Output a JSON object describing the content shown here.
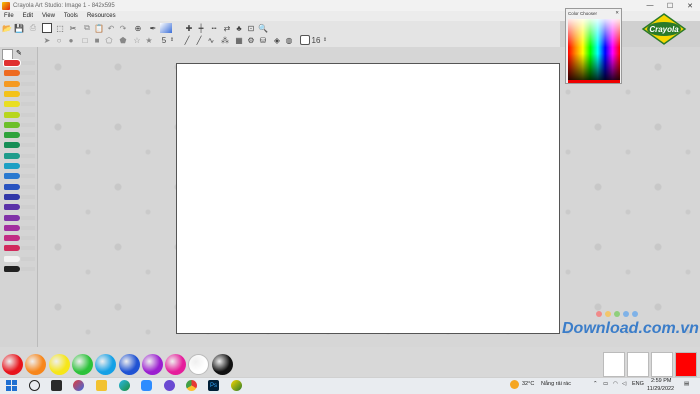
{
  "window": {
    "title": "Crayola Art Studio: Image 1 - 842x595",
    "min": "—",
    "max": "☐",
    "close": "✕"
  },
  "menu": [
    "File",
    "Edit",
    "View",
    "Tools",
    "Resources"
  ],
  "toolbar": {
    "size_value": "5",
    "brush_value": "16"
  },
  "color_chooser": {
    "title": "Color Chooser",
    "close": "✕",
    "selected_color": "#e00000"
  },
  "left_crayons": [
    "#e03030",
    "#ee6a20",
    "#f59a20",
    "#f3c21a",
    "#e9de22",
    "#b8d61e",
    "#6dbf2a",
    "#2fa33c",
    "#168e56",
    "#1f9c8c",
    "#1ea0c4",
    "#2b7ad0",
    "#2a53c0",
    "#3338a8",
    "#5b32a8",
    "#8132a8",
    "#a22d9e",
    "#c22c84",
    "#d12a5c",
    "#f2f2f2",
    "#222222"
  ],
  "bottom_colors": [
    "#e8141c",
    "#f7861b",
    "#f6e619",
    "#2cc23a",
    "#14a0e6",
    "#1f52d3",
    "#9b1fd0",
    "#e51d9b",
    "#ffffff",
    "#111111"
  ],
  "recent_swatches": [
    "#ffffff",
    "#ffffff",
    "#ffffff",
    "#ff0000"
  ],
  "watermark": {
    "text": "Download.com.vn",
    "dot_colors": [
      "#f08a8a",
      "#f3c66b",
      "#8fcf7c",
      "#7fb2e8",
      "#7fb2e8"
    ]
  },
  "logo": {
    "text": "Crayola"
  },
  "taskbar": {
    "weather_temp": "32°C",
    "weather_text": "Nắng rải rác",
    "lang": "ENG",
    "time": "2:59 PM",
    "date": "11/29/2022",
    "apps": [
      "start",
      "search",
      "task-view",
      "photos",
      "file-explorer",
      "edge",
      "zoom",
      "mail",
      "chrome",
      "photoshop",
      "crayola"
    ]
  }
}
